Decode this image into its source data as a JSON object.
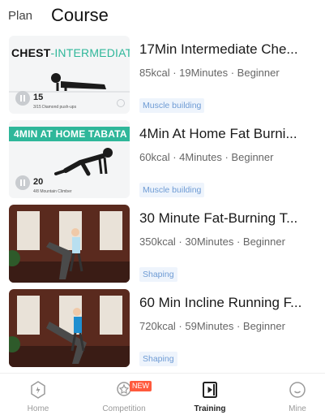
{
  "header": {
    "tabs": {
      "plan": "Plan",
      "course": "Course"
    }
  },
  "courses": [
    {
      "title": "17Min Intermediate Che...",
      "meta": "85kcal · 19Minutes · Beginner",
      "tag": "Muscle building",
      "thumb": {
        "banner_word1": "CHEST",
        "banner_word2": "-INTERMEDIATE",
        "count": "15",
        "caption": "3/15 Diamond push-ups"
      }
    },
    {
      "title": "4Min At Home Fat Burni...",
      "meta": "60kcal · 4Minutes · Beginner",
      "tag": "Muscle building",
      "thumb": {
        "banner": "4MIN AT HOME TABATA",
        "count": "20",
        "caption": "4/8 Mountain Climber"
      }
    },
    {
      "title": "30 Minute Fat-Burning T...",
      "meta": "350kcal · 30Minutes · Beginner",
      "tag": "Shaping"
    },
    {
      "title": "60 Min Incline Running F...",
      "meta": "720kcal · 59Minutes · Beginner",
      "tag": "Shaping"
    }
  ],
  "bottom_nav": {
    "home": "Home",
    "competition": "Competition",
    "competition_badge": "NEW",
    "training": "Training",
    "mine": "Mine"
  },
  "colors": {
    "accent_green": "#2fb79a",
    "tag_text": "#6e9bd4",
    "badge_red": "#ff5a3d"
  }
}
